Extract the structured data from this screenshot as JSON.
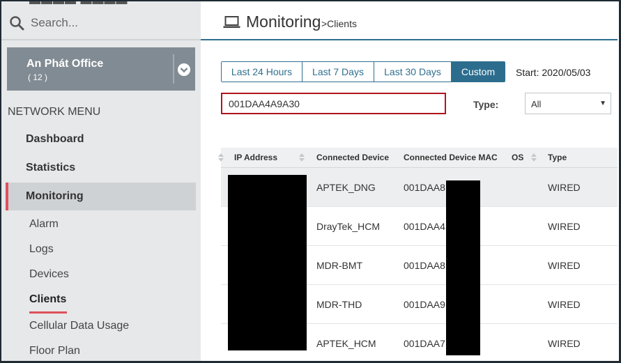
{
  "sidebar": {
    "search_placeholder": "Search...",
    "org": {
      "name": "An Phát Office",
      "count": "( 12 )"
    },
    "menu_heading": "NETWORK MENU",
    "nav": [
      {
        "label": "Dashboard"
      },
      {
        "label": "Statistics"
      },
      {
        "label": "Monitoring",
        "active": true
      }
    ],
    "sub_nav": [
      {
        "label": "Alarm"
      },
      {
        "label": "Logs"
      },
      {
        "label": "Devices"
      },
      {
        "label": "Clients",
        "active": true
      },
      {
        "label": "Cellular Data Usage"
      },
      {
        "label": "Floor Plan"
      }
    ]
  },
  "header": {
    "title": "Monitoring",
    "crumb": ">Clients"
  },
  "filters": {
    "ranges": [
      "Last 24 Hours",
      "Last 7 Days",
      "Last 30 Days",
      "Custom"
    ],
    "selected_range": "Custom",
    "start_label": "Start: 2020/05/03",
    "search_value": "001DAA4A9A30",
    "type_label": "Type:",
    "type_value": "All"
  },
  "table": {
    "columns": [
      "IP Address",
      "Connected Device",
      "Connected Device MAC",
      "OS",
      "Type"
    ],
    "rows": [
      {
        "device": "APTEK_DNG",
        "mac": "001DAA8",
        "type": "WIRED"
      },
      {
        "device": "DrayTek_HCM",
        "mac": "001DAA4",
        "type": "WIRED"
      },
      {
        "device": "MDR-BMT",
        "mac": "001DAA8",
        "type": "WIRED"
      },
      {
        "device": "MDR-THD",
        "mac": "001DAA9",
        "type": "WIRED"
      },
      {
        "device": "APTEK_HCM",
        "mac": "001DAA7",
        "type": "WIRED"
      }
    ]
  },
  "colors": {
    "accent": "#2c6d8e",
    "active_marker": "#e0505b",
    "alert_border": "#b0141d"
  }
}
